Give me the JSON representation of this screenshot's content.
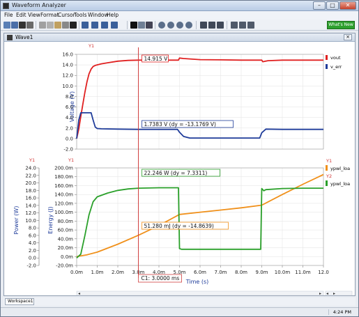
{
  "app": {
    "title": "Waveform Analyzer",
    "window_buttons": [
      "–",
      "□",
      "✕"
    ]
  },
  "menu": [
    "File",
    "Edit",
    "View",
    "Format",
    "Cursor",
    "Tools",
    "Window",
    "Help"
  ],
  "toolbar": {
    "whats_new": "What's New",
    "icons": [
      "new-icon",
      "open-icon",
      "save-icon",
      "print-icon",
      "cut-icon",
      "copy-icon",
      "paste-icon",
      "delete-icon",
      "properties-icon",
      "add-plot-icon",
      "add-axis-icon",
      "add-y-axis-icon",
      "remove-axis-icon",
      "crosshair-icon",
      "grid-icon",
      "cursor-icon",
      "zoom-in-icon",
      "zoom-out-icon",
      "zoom-fit-icon",
      "pan-icon",
      "measure-icon",
      "chart-icon",
      "export-icon",
      "tile-icon",
      "cascade-icon",
      "split-icon"
    ]
  },
  "document": {
    "title": "Wave1",
    "close": "×"
  },
  "colors": {
    "vout": "#e02020",
    "v_err": "#1f3c9a",
    "power": "#2aa02a",
    "energy": "#f0901a",
    "cursor": "#d04040"
  },
  "chart_data": [
    {
      "type": "line",
      "y_axis_label": "Y1",
      "ylabel": "Voltage (V)",
      "ylim": [
        -2.0,
        16.0
      ],
      "yticks": [
        "16.0",
        "14.0",
        "12.0",
        "10.0",
        "8.0",
        "6.0",
        "4.0",
        "2.0",
        "0.0",
        "-2.0"
      ],
      "xlim": [
        0,
        12
      ],
      "grid": true,
      "legend": [
        "vout",
        "v_err"
      ],
      "series": [
        {
          "name": "vout",
          "x": [
            0,
            0.1,
            0.2,
            0.3,
            0.4,
            0.5,
            0.6,
            0.7,
            0.8,
            0.9,
            1.0,
            1.2,
            1.5,
            2.0,
            2.5,
            3.0,
            4.0,
            4.95,
            5.0,
            5.2,
            6.0,
            7.0,
            8.0,
            9.0,
            9.05,
            9.3,
            10.0,
            11.0,
            12.0
          ],
          "y": [
            0,
            1.8,
            4.2,
            6.5,
            8.8,
            10.8,
            12.3,
            13.2,
            13.7,
            13.9,
            14.0,
            14.2,
            14.4,
            14.7,
            14.85,
            14.9,
            14.9,
            14.9,
            15.3,
            15.2,
            15.0,
            14.95,
            14.9,
            14.9,
            14.6,
            14.8,
            14.9,
            14.9,
            14.9
          ]
        },
        {
          "name": "v_err",
          "x": [
            0,
            0.1,
            0.2,
            0.3,
            0.7,
            0.8,
            0.9,
            1.0,
            1.2,
            2.0,
            3.0,
            4.0,
            4.9,
            5.0,
            5.2,
            5.5,
            6.0,
            7.0,
            8.0,
            8.9,
            9.0,
            9.2,
            10.0,
            11.0,
            12.0
          ],
          "y": [
            0,
            3.5,
            4.9,
            4.9,
            4.9,
            3.5,
            2.2,
            1.9,
            1.85,
            1.8,
            1.75,
            1.75,
            1.75,
            1.2,
            0.4,
            0.1,
            0.1,
            0.1,
            0.1,
            0.1,
            1.1,
            1.8,
            1.75,
            1.75,
            1.75
          ]
        }
      ],
      "annotations": [
        {
          "text": "14.915 V"
        },
        {
          "text": "1.7383 V (dy = -13.1769 V)"
        }
      ]
    },
    {
      "type": "line",
      "y_axis_label": "Y1",
      "y2_axis_label": "Y1",
      "ylabel": "Power (W)",
      "y2label": "Energy (J)",
      "ylim": [
        -2.0,
        24.0
      ],
      "y2lim": [
        -20.0,
        200.0
      ],
      "yticks": [
        "24.0",
        "22.0",
        "20.0",
        "18.0",
        "16.0",
        "14.0",
        "12.0",
        "10.0",
        "8.0",
        "6.0",
        "4.0",
        "2.0",
        "0.0",
        "-2.0"
      ],
      "y2ticks": [
        "200.0m",
        "180.0m",
        "160.0m",
        "140.0m",
        "120.0m",
        "100.0m",
        "80.0m",
        "60.0m",
        "40.0m",
        "20.0m",
        "0.0m",
        "-20.0m"
      ],
      "xlabel": "Time (s)",
      "xlim": [
        0,
        12
      ],
      "xticks": [
        "0.0m",
        "1.0m",
        "2.0m",
        "3.0m",
        "4.0m",
        "5.0m",
        "6.0m",
        "7.0m",
        "8.0m",
        "9.0m",
        "10.0m",
        "11.0m",
        "12.0"
      ],
      "grid": true,
      "legend": [
        "Y1",
        "ypwl_loa",
        "Y2",
        "ypwl_loa"
      ],
      "series": [
        {
          "name": "ypwl_loa",
          "axis": "Y1",
          "x": [
            0,
            0.2,
            0.4,
            0.6,
            0.8,
            1.0,
            1.5,
            2.0,
            2.5,
            3.0,
            4.0,
            4.95,
            5.0,
            5.1,
            6.0,
            7.0,
            8.0,
            8.95,
            9.0,
            9.1,
            9.2,
            10.0,
            11.0,
            12.0
          ],
          "y": [
            0,
            1.0,
            6.0,
            11.5,
            15.0,
            16.3,
            17.3,
            18.0,
            18.4,
            18.6,
            18.7,
            18.7,
            2.5,
            2.3,
            2.3,
            2.3,
            2.3,
            2.3,
            18.5,
            17.9,
            18.2,
            18.5,
            18.6,
            18.6
          ]
        },
        {
          "name": "ypwl_loa",
          "axis": "Y2",
          "x": [
            0,
            0.5,
            1.0,
            2.0,
            3.0,
            4.0,
            5.0,
            6.0,
            7.0,
            8.0,
            9.0,
            10.0,
            11.0,
            12.0
          ],
          "y": [
            0,
            4,
            10,
            28,
            48,
            70,
            95,
            100,
            105,
            110,
            116,
            140,
            163,
            185
          ]
        }
      ],
      "annotations": [
        {
          "text": "22.246 W (dy = 7.3311)"
        },
        {
          "text": "51.280 mJ (dy = -14.8639)"
        }
      ],
      "cursor": {
        "label": "C1: 3.0000 ms",
        "x": 3.0
      }
    }
  ],
  "tabs": [
    "Workspace1"
  ],
  "status": {
    "time": "4:24 PM"
  }
}
